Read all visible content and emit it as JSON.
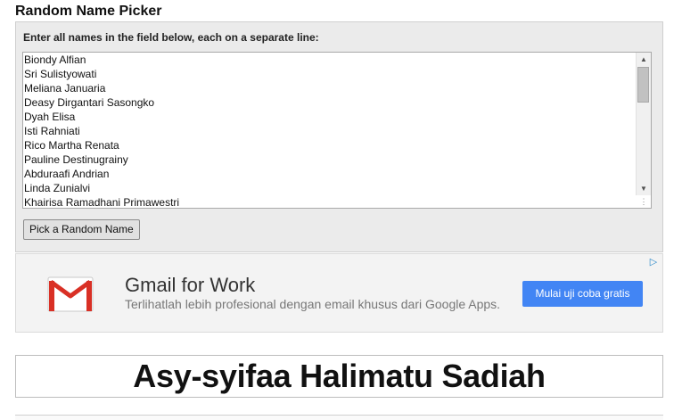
{
  "page_title": "Random Name Picker",
  "instructions": "Enter all names in the field below, each on a separate line:",
  "names": [
    "Biondy Alfian",
    "Sri Sulistyowati",
    "Meliana Januaria",
    "Deasy Dirgantari Sasongko",
    "Dyah Elisa",
    "Isti Rahniati",
    "Rico Martha Renata",
    "Pauline Destinugrainy",
    "Abduraafi Andrian",
    "Linda Zunialvi",
    "Khairisa Ramadhani Primawestri"
  ],
  "pick_button_label": "Pick a Random Name",
  "ad": {
    "headline": "Gmail for Work",
    "subtext": "Terlihatlah lebih profesional dengan email khusus dari Google Apps.",
    "cta_label": "Mulai uji coba gratis",
    "logo_icon": "gmail-logo-icon",
    "choices_icon": "ad-choices-icon",
    "cta_color": "#4285f4"
  },
  "result": "Asy-syifaa Halimatu Sadiah",
  "scrollbar": {
    "up_icon": "scroll-up-arrow-icon",
    "down_icon": "scroll-down-arrow-icon",
    "resize_icon": "resize-handle-icon"
  }
}
